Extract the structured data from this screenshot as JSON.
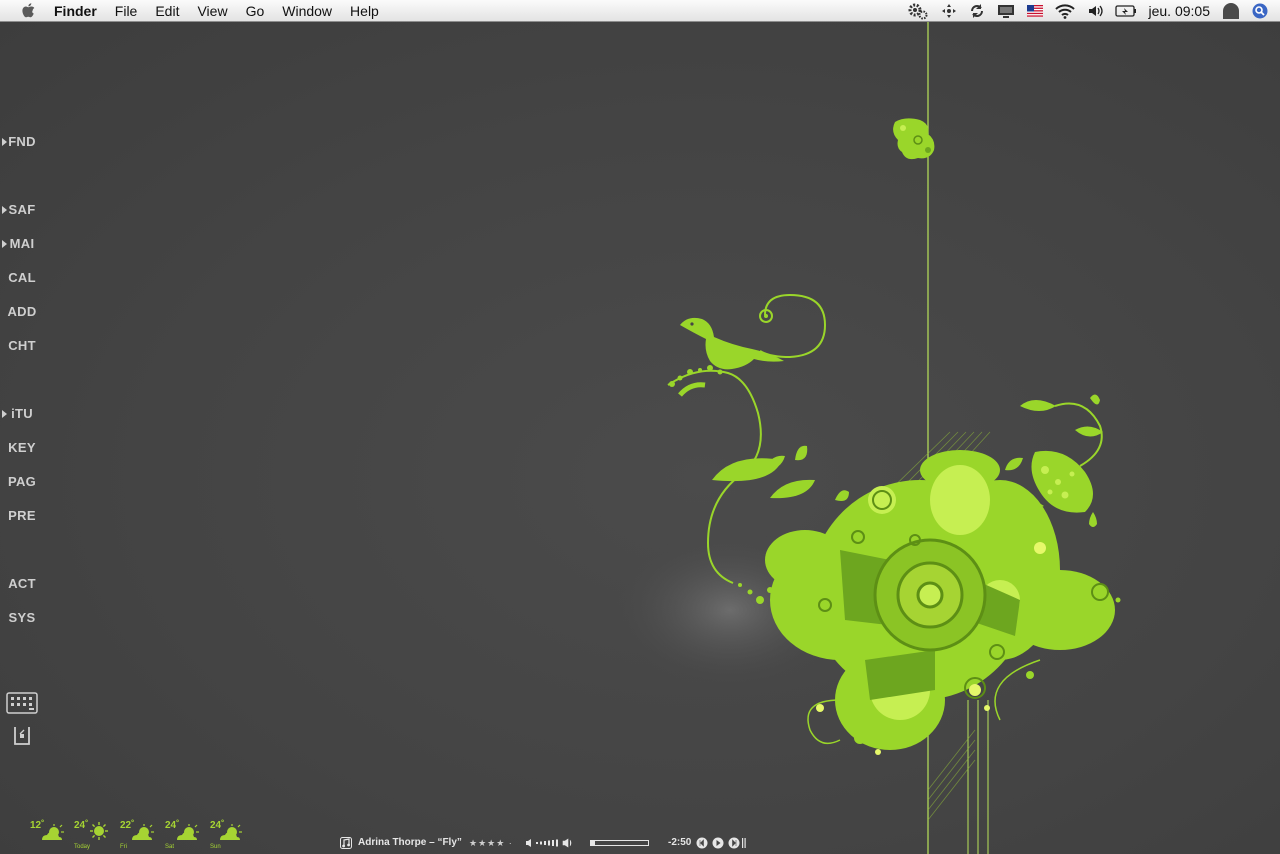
{
  "menubar": {
    "app_name": "Finder",
    "menus": [
      "File",
      "Edit",
      "View",
      "Go",
      "Window",
      "Help"
    ],
    "clock": "jeu. 09:05",
    "status_icons": [
      "gear-icon",
      "move-icon",
      "sync-icon",
      "display-icon",
      "us-flag-icon",
      "wifi-icon",
      "volume-icon",
      "battery-icon",
      "user-icon",
      "spotlight-icon"
    ]
  },
  "launcher": {
    "items": [
      {
        "label": "FND",
        "running": true
      },
      {
        "label": "SAF",
        "running": true
      },
      {
        "label": "MAI",
        "running": true
      },
      {
        "label": "CAL",
        "running": false
      },
      {
        "label": "ADD",
        "running": false
      },
      {
        "label": "CHT",
        "running": false
      },
      {
        "label": "iTU",
        "running": true
      },
      {
        "label": "KEY",
        "running": false
      },
      {
        "label": "PAG",
        "running": false
      },
      {
        "label": "PRE",
        "running": false
      },
      {
        "label": "ACT",
        "running": false
      },
      {
        "label": "SYS",
        "running": false
      }
    ],
    "bottom_icons": [
      "grid-icon",
      "trash-icon"
    ]
  },
  "weather": [
    {
      "temp": "12˚",
      "day": "",
      "icon": "partly-cloudy-icon"
    },
    {
      "temp": "24˚",
      "day": "Today",
      "icon": "sun-icon"
    },
    {
      "temp": "22˚",
      "day": "Fri",
      "icon": "partly-cloudy-icon"
    },
    {
      "temp": "24˚",
      "day": "Sat",
      "icon": "partly-cloudy-icon"
    },
    {
      "temp": "24˚",
      "day": "Sun",
      "icon": "partly-cloudy-icon"
    }
  ],
  "itunes": {
    "track": "Adrina Thorpe – “Fly”",
    "rating": "★★★★ ·",
    "remaining": "-2:50"
  },
  "colors": {
    "accent": "#9ad62a",
    "background": "#464646",
    "launcher_text": "#cfcfcf"
  }
}
